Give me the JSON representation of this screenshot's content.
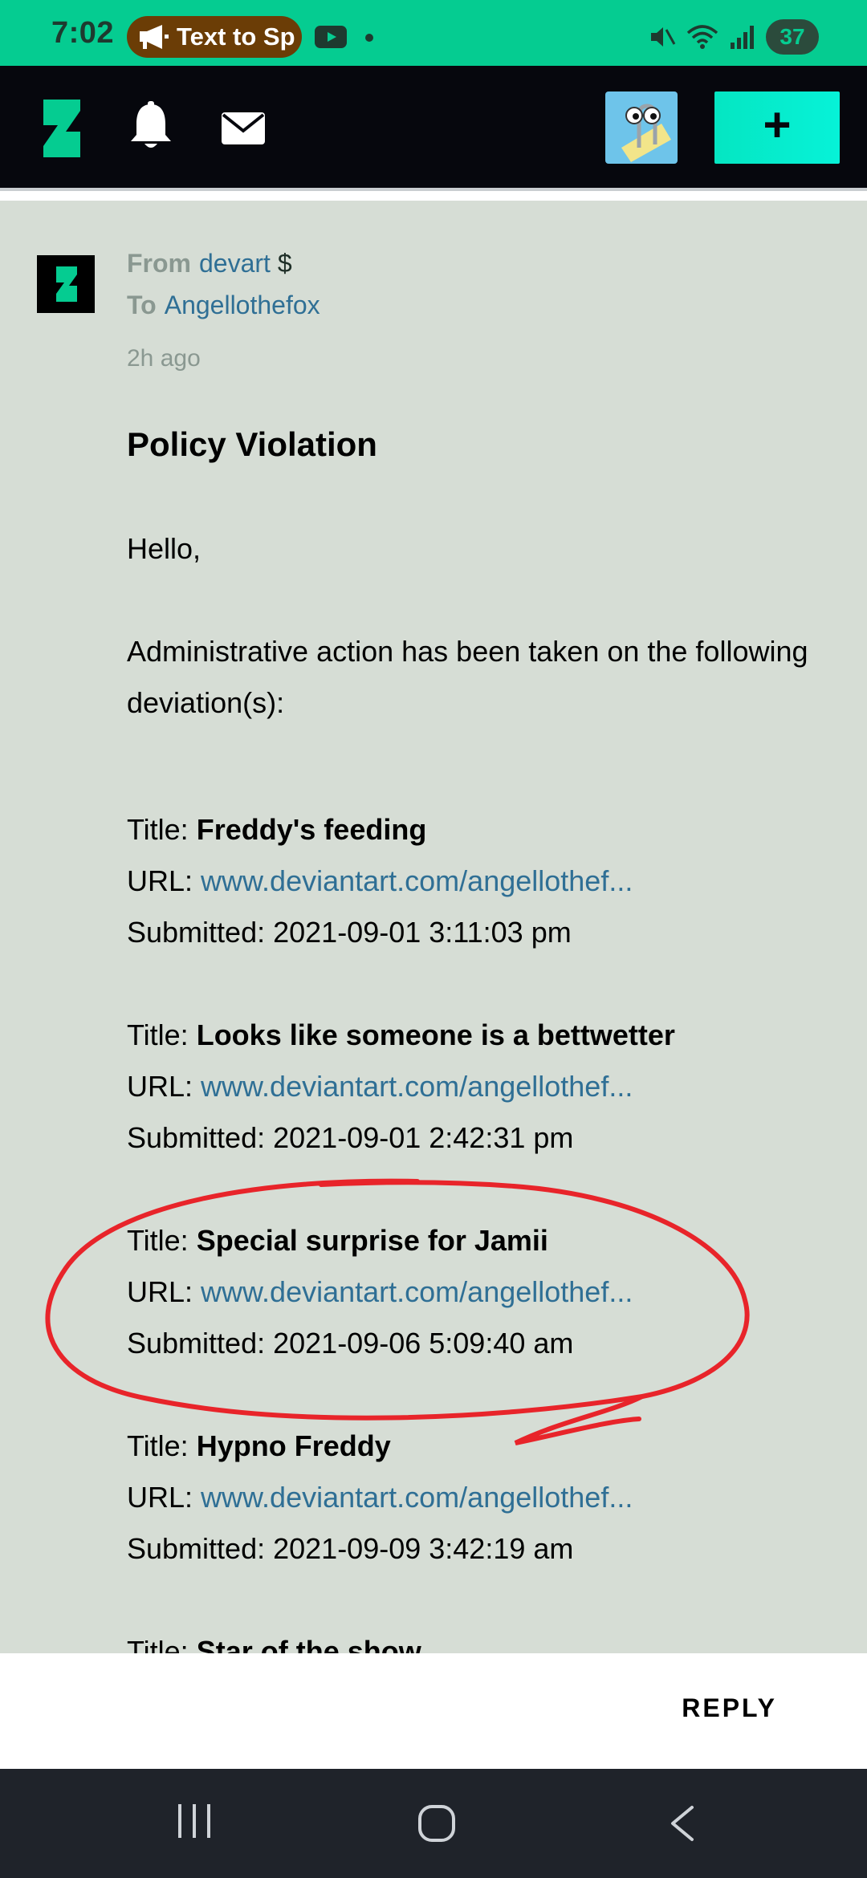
{
  "status_bar": {
    "time": "7:02",
    "notification_pill": "Text to Sp",
    "battery": "37"
  },
  "header": {
    "create_label": "+"
  },
  "message": {
    "from_label": "From",
    "from_user": "devart",
    "from_badge": "$",
    "to_label": "To",
    "to_user": "Angellothefox",
    "time_ago": "2h ago",
    "subject": "Policy Violation",
    "greeting": "Hello,",
    "intro": "Administrative action has been taken on the following deviation(s):",
    "entry_title_label": "Title:",
    "entry_url_label": "URL:",
    "entry_submitted_label": "Submitted:",
    "entries": [
      {
        "title": "Freddy's feeding",
        "url": "www.deviantart.com/angellothef...",
        "submitted": "2021-09-01 3:11:03 pm"
      },
      {
        "title": "Looks like someone is a bettwetter",
        "url": "www.deviantart.com/angellothef...",
        "submitted": "2021-09-01 2:42:31 pm"
      },
      {
        "title": "Special surprise for Jamii",
        "url": "www.deviantart.com/angellothef...",
        "submitted": "2021-09-06 5:09:40 am"
      },
      {
        "title": "Hypno Freddy",
        "url": "www.deviantart.com/angellothef...",
        "submitted": "2021-09-09 3:42:19 am"
      },
      {
        "title": "Star of the show"
      }
    ]
  },
  "reply_label": "REPLY",
  "colors": {
    "status_bar": "#05cc91",
    "header": "#06070d",
    "accent": "#06f2d8",
    "content_bg": "#d6ddd5",
    "link": "#2f6f95",
    "annotation": "#e8242a"
  },
  "icons": [
    "megaphone-icon",
    "youtube-icon",
    "mute-icon",
    "wifi-icon",
    "signal-icon",
    "deviantart-logo-icon",
    "bell-icon",
    "mail-icon",
    "recent-apps-icon",
    "home-icon",
    "back-icon"
  ]
}
